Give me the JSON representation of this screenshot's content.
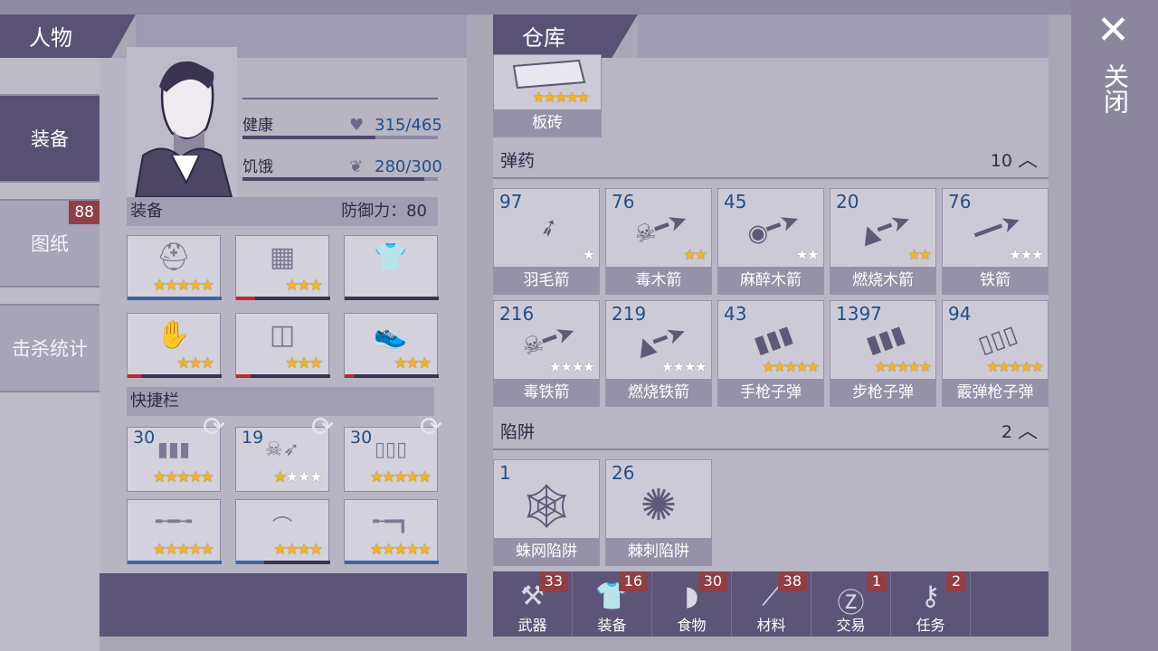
{
  "character": {
    "header": "人物",
    "health_label": "健康",
    "health_value": "315/465",
    "health_fraction": 0.68,
    "hunger_label": "饥饿",
    "hunger_value": "280/300",
    "hunger_fraction": 0.93,
    "equip_label": "装备",
    "defense": "防御力：80",
    "quickbar_label": "快捷栏",
    "equip_slots": [
      {
        "icon": "helmet-icon",
        "stars": 5,
        "durability": 1.0,
        "dur_color": "#3a66a8"
      },
      {
        "icon": "armor-vest-icon",
        "stars": 3,
        "durability": 0.2,
        "dur_color": "#c0282e"
      },
      {
        "icon": "jacket-icon",
        "stars": 0,
        "durability": 0,
        "dur_color": "#3a3450"
      },
      {
        "icon": "gloves-icon",
        "stars": 3,
        "durability": 0.15,
        "dur_color": "#c0282e"
      },
      {
        "icon": "shorts-icon",
        "stars": 3,
        "durability": 0.15,
        "dur_color": "#c0282e"
      },
      {
        "icon": "sneakers-icon",
        "stars": 3,
        "durability": 0.1,
        "dur_color": "#c0282e"
      }
    ],
    "quick_slots": [
      {
        "count": "30",
        "icon": "rifle-bullets-icon",
        "stars": 5,
        "gold": 5
      },
      {
        "count": "19",
        "icon": "poison-arrow-icon",
        "stars": 4,
        "gold": 1
      },
      {
        "count": "30",
        "icon": "shotgun-shells-icon",
        "stars": 5,
        "gold": 5
      },
      {
        "count": "",
        "icon": "rifle-icon",
        "stars": 5,
        "gold": 5
      },
      {
        "count": "",
        "icon": "bow-icon",
        "stars": 4,
        "gold": 4
      },
      {
        "count": "",
        "icon": "shotgun-icon",
        "stars": 5,
        "gold": 5
      }
    ]
  },
  "nav": {
    "tabs": [
      "装备",
      "图纸",
      "击杀统计"
    ],
    "blueprint_badge": "88"
  },
  "warehouse": {
    "header": "仓库",
    "top_item": {
      "label": "板砖",
      "stars": 5
    },
    "categories": [
      {
        "label": "弹药",
        "count": "10"
      },
      {
        "label": "陷阱",
        "count": "2"
      }
    ],
    "ammo": [
      {
        "num": "97",
        "label": "羽毛箭",
        "stars": 1,
        "gold": 0,
        "icon": "feather-arrow-icon"
      },
      {
        "num": "76",
        "label": "毒木箭",
        "stars": 2,
        "gold": 2,
        "icon": "poison-wood-arrow-icon"
      },
      {
        "num": "45",
        "label": "麻醉木箭",
        "stars": 2,
        "gold": 0,
        "icon": "tranq-arrow-icon"
      },
      {
        "num": "20",
        "label": "燃烧木箭",
        "stars": 2,
        "gold": 2,
        "icon": "fire-wood-arrow-icon"
      },
      {
        "num": "76",
        "label": "铁箭",
        "stars": 3,
        "gold": 0,
        "icon": "iron-arrow-icon"
      },
      {
        "num": "216",
        "label": "毒铁箭",
        "stars": 4,
        "gold": 0,
        "icon": "poison-iron-arrow-icon"
      },
      {
        "num": "219",
        "label": "燃烧铁箭",
        "stars": 4,
        "gold": 0,
        "icon": "fire-iron-arrow-icon"
      },
      {
        "num": "43",
        "label": "手枪子弹",
        "stars": 5,
        "gold": 5,
        "icon": "pistol-bullets-icon"
      },
      {
        "num": "1397",
        "label": "步枪子弹",
        "stars": 5,
        "gold": 5,
        "icon": "rifle-bullets-icon"
      },
      {
        "num": "94",
        "label": "霰弹枪子弹",
        "stars": 5,
        "gold": 5,
        "icon": "shotgun-shells-icon"
      }
    ],
    "traps": [
      {
        "num": "1",
        "label": "蛛网陷阱",
        "icon": "spiderweb-trap-icon"
      },
      {
        "num": "26",
        "label": "棘刺陷阱",
        "icon": "spike-trap-icon"
      }
    ]
  },
  "bottom_tabs": [
    {
      "label": "武器",
      "badge": "33",
      "icon": "axe-icon"
    },
    {
      "label": "装备",
      "badge": "16",
      "icon": "shirt-icon"
    },
    {
      "label": "食物",
      "badge": "30",
      "icon": "meat-icon"
    },
    {
      "label": "材料",
      "badge": "38",
      "icon": "log-icon"
    },
    {
      "label": "交易",
      "badge": "1",
      "icon": "coin-icon"
    },
    {
      "label": "任务",
      "badge": "2",
      "icon": "key-icon"
    }
  ],
  "close_label": "关闭"
}
